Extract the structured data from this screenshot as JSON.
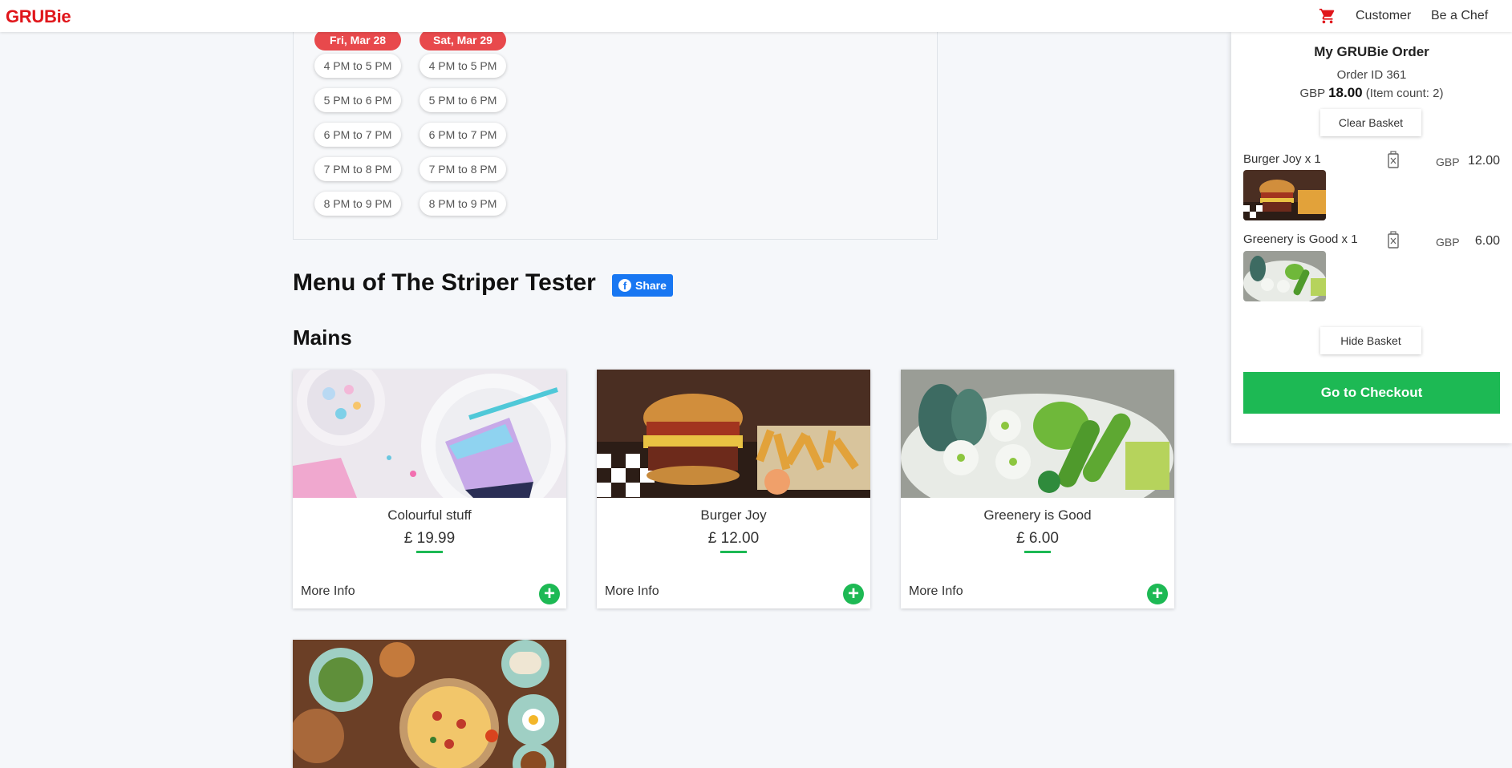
{
  "brand": {
    "logo_text": "GRUBie",
    "color": "#e0161b"
  },
  "nav": {
    "cart_icon": "shopping-cart-icon",
    "customer_label": "Customer",
    "chef_label": "Be a Chef"
  },
  "schedule": {
    "days": [
      "Fri, Mar 28",
      "Sat, Mar 29"
    ],
    "slots": [
      "4 PM to 5 PM",
      "5 PM to 6 PM",
      "6 PM to 7 PM",
      "7 PM to 8 PM",
      "8 PM to 9 PM"
    ]
  },
  "menu": {
    "title": "Menu of The Striper Tester",
    "share_label": "Share",
    "section": "Mains",
    "items": [
      {
        "name": "Colourful stuff",
        "price": "£ 19.99",
        "more": "More Info"
      },
      {
        "name": "Burger Joy",
        "price": "£ 12.00",
        "more": "More Info"
      },
      {
        "name": "Greenery is Good",
        "price": "£ 6.00",
        "more": "More Info"
      }
    ]
  },
  "basket": {
    "title": "My GRUBie Order",
    "order_id_label": "Order ID",
    "order_id": "361",
    "currency": "GBP",
    "total": "18.00",
    "item_count_label": "(Item count:",
    "item_count": "2)",
    "clear_label": "Clear Basket",
    "items": [
      {
        "name": "Burger Joy x 1",
        "currency": "GBP",
        "amount": "12.00"
      },
      {
        "name": "Greenery is Good x 1",
        "currency": "GBP",
        "amount": "6.00"
      }
    ],
    "hide_label": "Hide Basket",
    "checkout_label": "Go to Checkout"
  },
  "colors": {
    "accent_green": "#1db954",
    "pill_red": "#e8494c",
    "facebook_blue": "#1877f2"
  }
}
